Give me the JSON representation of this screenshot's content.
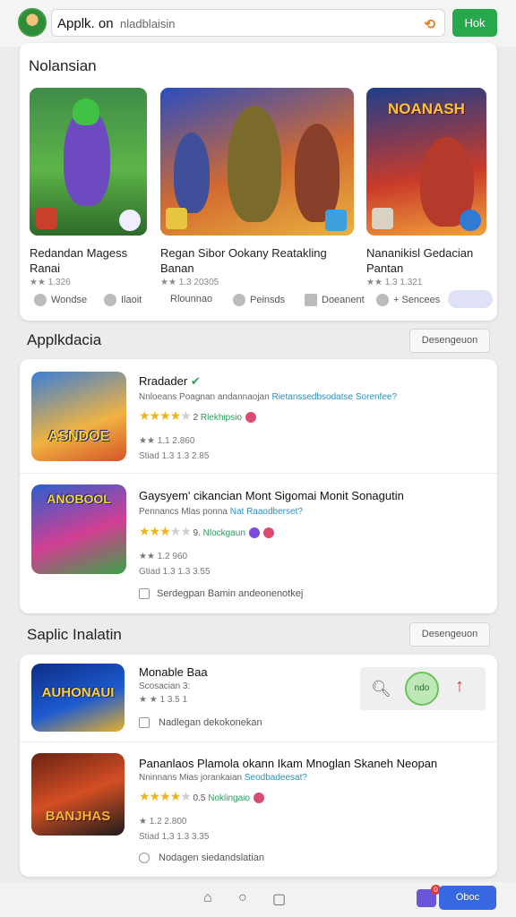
{
  "topbar": {
    "search_query": "Applk. on",
    "search_hint": "nladblaisin",
    "search_button": "Hok"
  },
  "featured": {
    "title": "Nolansian",
    "tiles": [
      {
        "name": "Redandan Magess Ranai",
        "meta": "★★ 1.326"
      },
      {
        "name": "Regan Sibor Ookany Reatakling Banan",
        "meta": "★★ 1.3 20305"
      },
      {
        "name": "Nananikisl Gedacian Pantan",
        "meta": "★★ 1.3 1.321"
      }
    ],
    "actions": [
      "Wondse",
      "Ilaoit",
      "Rlounnao",
      "Peinsds",
      "Doeanent",
      "+ Sencees"
    ]
  },
  "section1": {
    "title": "Applkdacia",
    "more_button": "Desengeuon",
    "items": [
      {
        "name": "Rradader",
        "sub": "Nnloeans Poagnan andannaojan",
        "sub_link": "Rietanssedbsodatse Sorenfee?",
        "rating_count": "2",
        "tag": "Rlekhipsio",
        "line1": "★★ 1.1 2.860",
        "line2": "Stiad 1.3 1.3 2.85"
      },
      {
        "name": "Gaysyem' cikancian Mont Sigomai Monit Sonagutin",
        "sub": "Pennancs Mlas ponna",
        "sub_link": "Nat Raaodberset?",
        "rating_count": "9.",
        "tag": "Nlockgaun",
        "line1": "★★ 1.2 960",
        "line2": "Gtiad 1.3 1.3 3.55",
        "footer": "Serdegpan Bamin andeonenotkej"
      }
    ]
  },
  "section2": {
    "title": "Saplic Inalatin",
    "more_button": "Desengeuon",
    "items": [
      {
        "name": "Monable Baa",
        "sub": "Scosacian 3:",
        "line1": "★ ★ 1 3.5 1",
        "footer": "Nadlegan dekokonekan",
        "quick_mid": "ndo"
      },
      {
        "name": "Pananlaos Plamola okann Ikam Mnoglan Skaneh Neopan",
        "sub": "Nninnans Mias jorankaian",
        "sub_link": "Seodbadeesat?",
        "rating_count": "0.5",
        "tag": "Noklingaio",
        "line1": "★ 1.2 2.800",
        "line2": "Stiad 1.3 1.3 3.35",
        "footer": "Nodagen siedandslatian"
      }
    ]
  },
  "icons": {
    "art_words": [
      "NOANASH",
      "ASNDOE",
      "ANOBOOL",
      "AUHONAUI",
      "BANJHAS"
    ]
  },
  "bottomnav": {
    "badge_count": "0",
    "button_label": "Oboc"
  },
  "colors": {
    "accent_green": "#26a84b",
    "accent_blue": "#3768e2",
    "star": "#f1b31c",
    "link": "#2b8fbd"
  }
}
